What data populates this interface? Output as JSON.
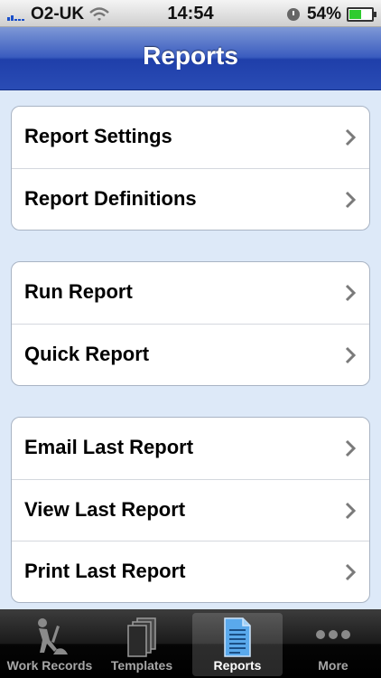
{
  "status_bar": {
    "carrier": "O2-UK",
    "time": "14:54",
    "battery_percent": "54%",
    "battery_level": 0.54
  },
  "navbar": {
    "title": "Reports"
  },
  "groups": [
    {
      "rows": [
        {
          "label": "Report Settings"
        },
        {
          "label": "Report Definitions"
        }
      ]
    },
    {
      "rows": [
        {
          "label": "Run Report"
        },
        {
          "label": "Quick Report"
        }
      ]
    },
    {
      "rows": [
        {
          "label": "Email Last Report"
        },
        {
          "label": "View Last Report"
        },
        {
          "label": "Print Last Report"
        }
      ]
    }
  ],
  "tabs": [
    {
      "label": "Work Records",
      "icon": "worker-icon",
      "selected": false
    },
    {
      "label": "Templates",
      "icon": "templates-icon",
      "selected": false
    },
    {
      "label": "Reports",
      "icon": "report-document-icon",
      "selected": true
    },
    {
      "label": "More",
      "icon": "more-dots-icon",
      "selected": false
    }
  ],
  "colors": {
    "nav_blue": "#2a4cb5",
    "background": "#dde9f8",
    "battery_green": "#2ecb2e"
  }
}
